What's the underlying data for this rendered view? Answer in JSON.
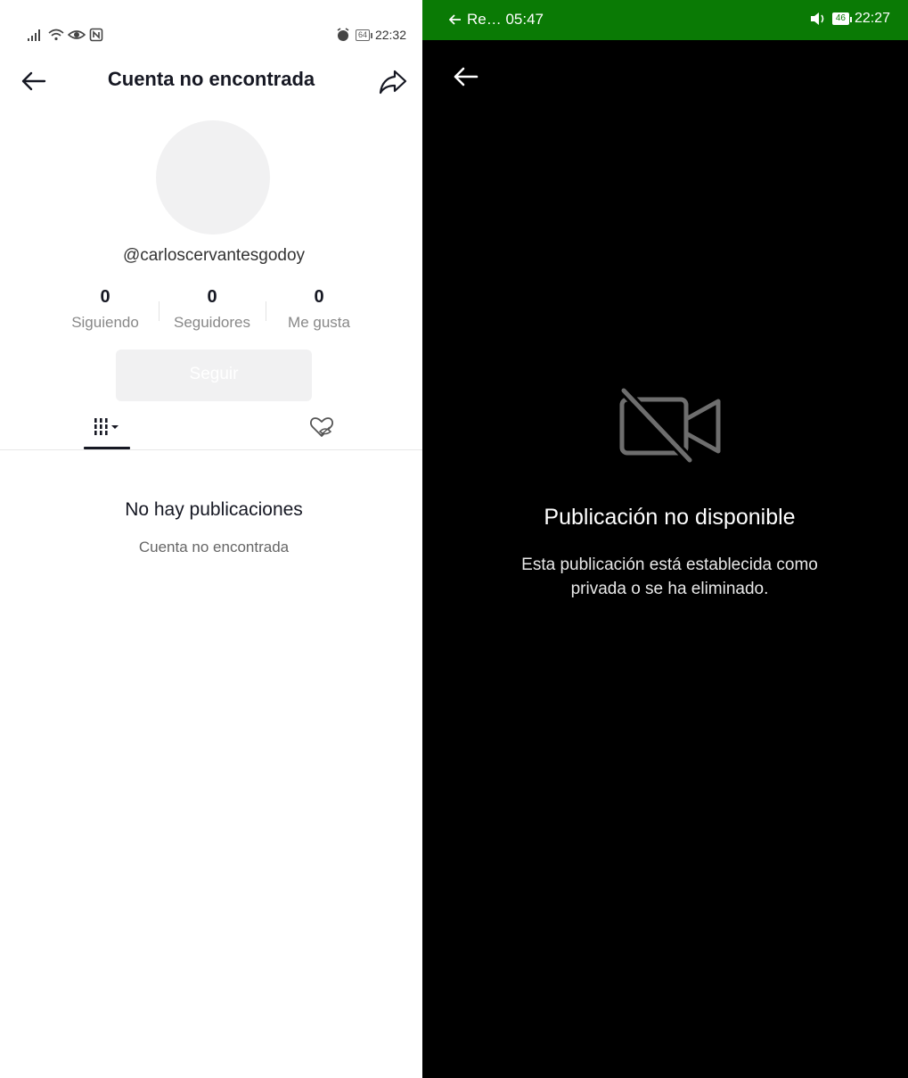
{
  "left": {
    "status_bar": {
      "time": "22:32",
      "battery": "64"
    },
    "header": {
      "title": "Cuenta no encontrada"
    },
    "profile": {
      "username": "@carloscervantesgodoy"
    },
    "stats": [
      {
        "value": "0",
        "label": "Siguiendo"
      },
      {
        "value": "0",
        "label": "Seguidores"
      },
      {
        "value": "0",
        "label": "Me gusta"
      }
    ],
    "follow_label": "Seguir",
    "empty": {
      "title": "No hay publicaciones",
      "subtitle": "Cuenta no encontrada"
    }
  },
  "right": {
    "status_bar": {
      "back_label": "Re… 05:47",
      "time": "22:27",
      "battery": "46",
      "color": "#0a7a05"
    },
    "message": {
      "title": "Publicación no disponible",
      "line1": "Esta publicación está establecida como",
      "line2": "privada o se ha eliminado."
    }
  }
}
